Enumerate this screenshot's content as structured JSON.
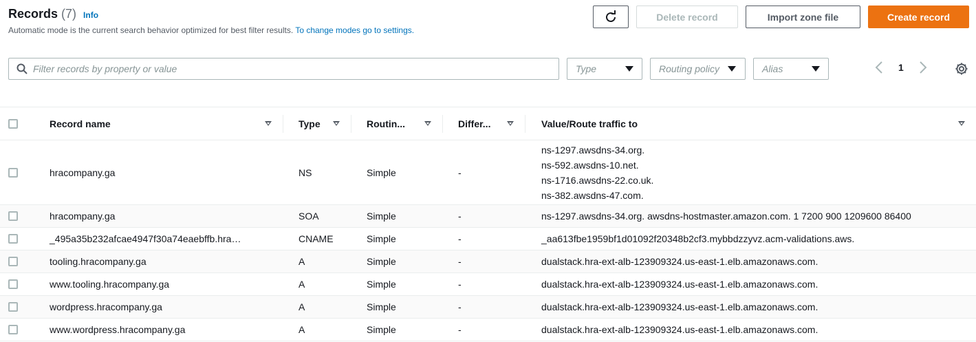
{
  "header": {
    "title": "Records",
    "count": "(7)",
    "info": "Info",
    "description": "Automatic mode is the current search behavior optimized for best filter results.",
    "settings_link": "To change modes go to settings."
  },
  "toolbar": {
    "delete_label": "Delete record",
    "import_label": "Import zone file",
    "create_label": "Create record"
  },
  "filters": {
    "search_placeholder": "Filter records by property or value",
    "type_label": "Type",
    "routing_label": "Routing policy",
    "alias_label": "Alias"
  },
  "pagination": {
    "current_page": "1"
  },
  "table": {
    "columns": [
      "Record name",
      "Type",
      "Routin...",
      "Differ...",
      "Value/Route traffic to"
    ],
    "rows": [
      {
        "name": "hracompany.ga",
        "type": "NS",
        "routing": "Simple",
        "differ": "-",
        "values": [
          "ns-1297.awsdns-34.org.",
          "ns-592.awsdns-10.net.",
          "ns-1716.awsdns-22.co.uk.",
          "ns-382.awsdns-47.com."
        ]
      },
      {
        "name": "hracompany.ga",
        "type": "SOA",
        "routing": "Simple",
        "differ": "-",
        "values": [
          "ns-1297.awsdns-34.org. awsdns-hostmaster.amazon.com. 1 7200 900 1209600 86400"
        ]
      },
      {
        "name": "_495a35b232afcae4947f30a74eaebffb.hra…",
        "type": "CNAME",
        "routing": "Simple",
        "differ": "-",
        "values": [
          "_aa613fbe1959bf1d01092f20348b2cf3.mybbdzzyvz.acm-validations.aws."
        ]
      },
      {
        "name": "tooling.hracompany.ga",
        "type": "A",
        "routing": "Simple",
        "differ": "-",
        "values": [
          "dualstack.hra-ext-alb-123909324.us-east-1.elb.amazonaws.com."
        ]
      },
      {
        "name": "www.tooling.hracompany.ga",
        "type": "A",
        "routing": "Simple",
        "differ": "-",
        "values": [
          "dualstack.hra-ext-alb-123909324.us-east-1.elb.amazonaws.com."
        ]
      },
      {
        "name": "wordpress.hracompany.ga",
        "type": "A",
        "routing": "Simple",
        "differ": "-",
        "values": [
          "dualstack.hra-ext-alb-123909324.us-east-1.elb.amazonaws.com."
        ]
      },
      {
        "name": "www.wordpress.hracompany.ga",
        "type": "A",
        "routing": "Simple",
        "differ": "-",
        "values": [
          "dualstack.hra-ext-alb-123909324.us-east-1.elb.amazonaws.com."
        ]
      }
    ]
  },
  "colors": {
    "primary": "#ec7211",
    "link": "#0073bb",
    "border": "#aab7b8"
  }
}
